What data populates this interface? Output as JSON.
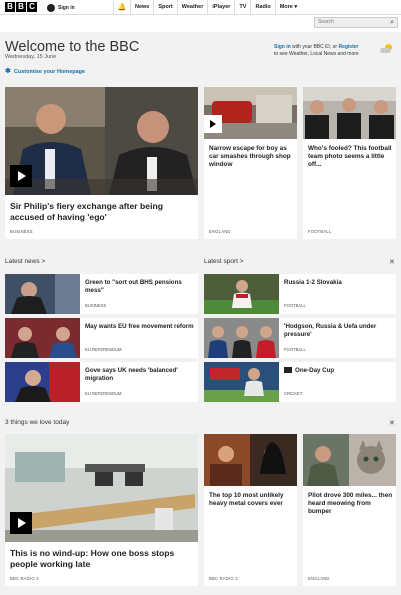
{
  "header": {
    "logo_letters": [
      "B",
      "B",
      "C"
    ],
    "signin_label": "Sign in",
    "nav": [
      "News",
      "Sport",
      "Weather",
      "iPlayer",
      "TV",
      "Radio",
      "More"
    ],
    "search_placeholder": "Search"
  },
  "welcome": {
    "title": "Welcome to the BBC",
    "date": "Wednesday, 15 June",
    "customise": "Customise your Homepage",
    "signin_link": "Sign in",
    "signin_mid": " with your BBC iD, or ",
    "register_link": "Register",
    "signin_tail": "to see Weather, Local News and more"
  },
  "top_stories": [
    {
      "headline": "Sir Philip's fiery exchange after being accused of having 'ego'",
      "tag": "BUSINESS"
    },
    {
      "headline": "Narrow escape for boy as car smashes through shop window",
      "tag": "ENGLAND"
    },
    {
      "headline": "Who's fooled? This football team photo seems a little off...",
      "tag": "FOOTBALL"
    }
  ],
  "latest_news": {
    "heading": "Latest news",
    "items": [
      {
        "title": "Green to \"sort out BHS pensions mess\"",
        "tag": "BUSINESS"
      },
      {
        "title": "May wants EU free movement reform",
        "tag": "EU REFERENDUM"
      },
      {
        "title": "Gove says UK needs 'balanced' migration",
        "tag": "EU REFERENDUM"
      }
    ]
  },
  "latest_sport": {
    "heading": "Latest sport",
    "items": [
      {
        "title": "Russia 1-2 Slovakia",
        "tag": "FOOTBALL"
      },
      {
        "title": "'Hodgson, Russia & Uefa under pressure'",
        "tag": "FOOTBALL"
      },
      {
        "title": "One-Day Cup",
        "tag": "CRICKET"
      }
    ]
  },
  "three_things": {
    "heading": "3 things we love today",
    "items": [
      {
        "headline": "This is no wind-up: How one boss stops people working late",
        "tag": "BBC RADIO 4"
      },
      {
        "headline": "The top 10 most unlikely heavy metal covers ever",
        "tag": "BBC RADIO 2"
      },
      {
        "headline": "Pilot drove 300 miles... then heard meowing from bumper",
        "tag": "ENGLAND"
      }
    ]
  },
  "icons": {
    "section_arrow": ">",
    "close": "✕",
    "more_caret": "▾",
    "bell": "🔔",
    "search": "⌕",
    "gear": "✱"
  },
  "colors": {
    "link": "#1a6ea8",
    "background": "#f2f2f2",
    "brand": "#000000"
  }
}
